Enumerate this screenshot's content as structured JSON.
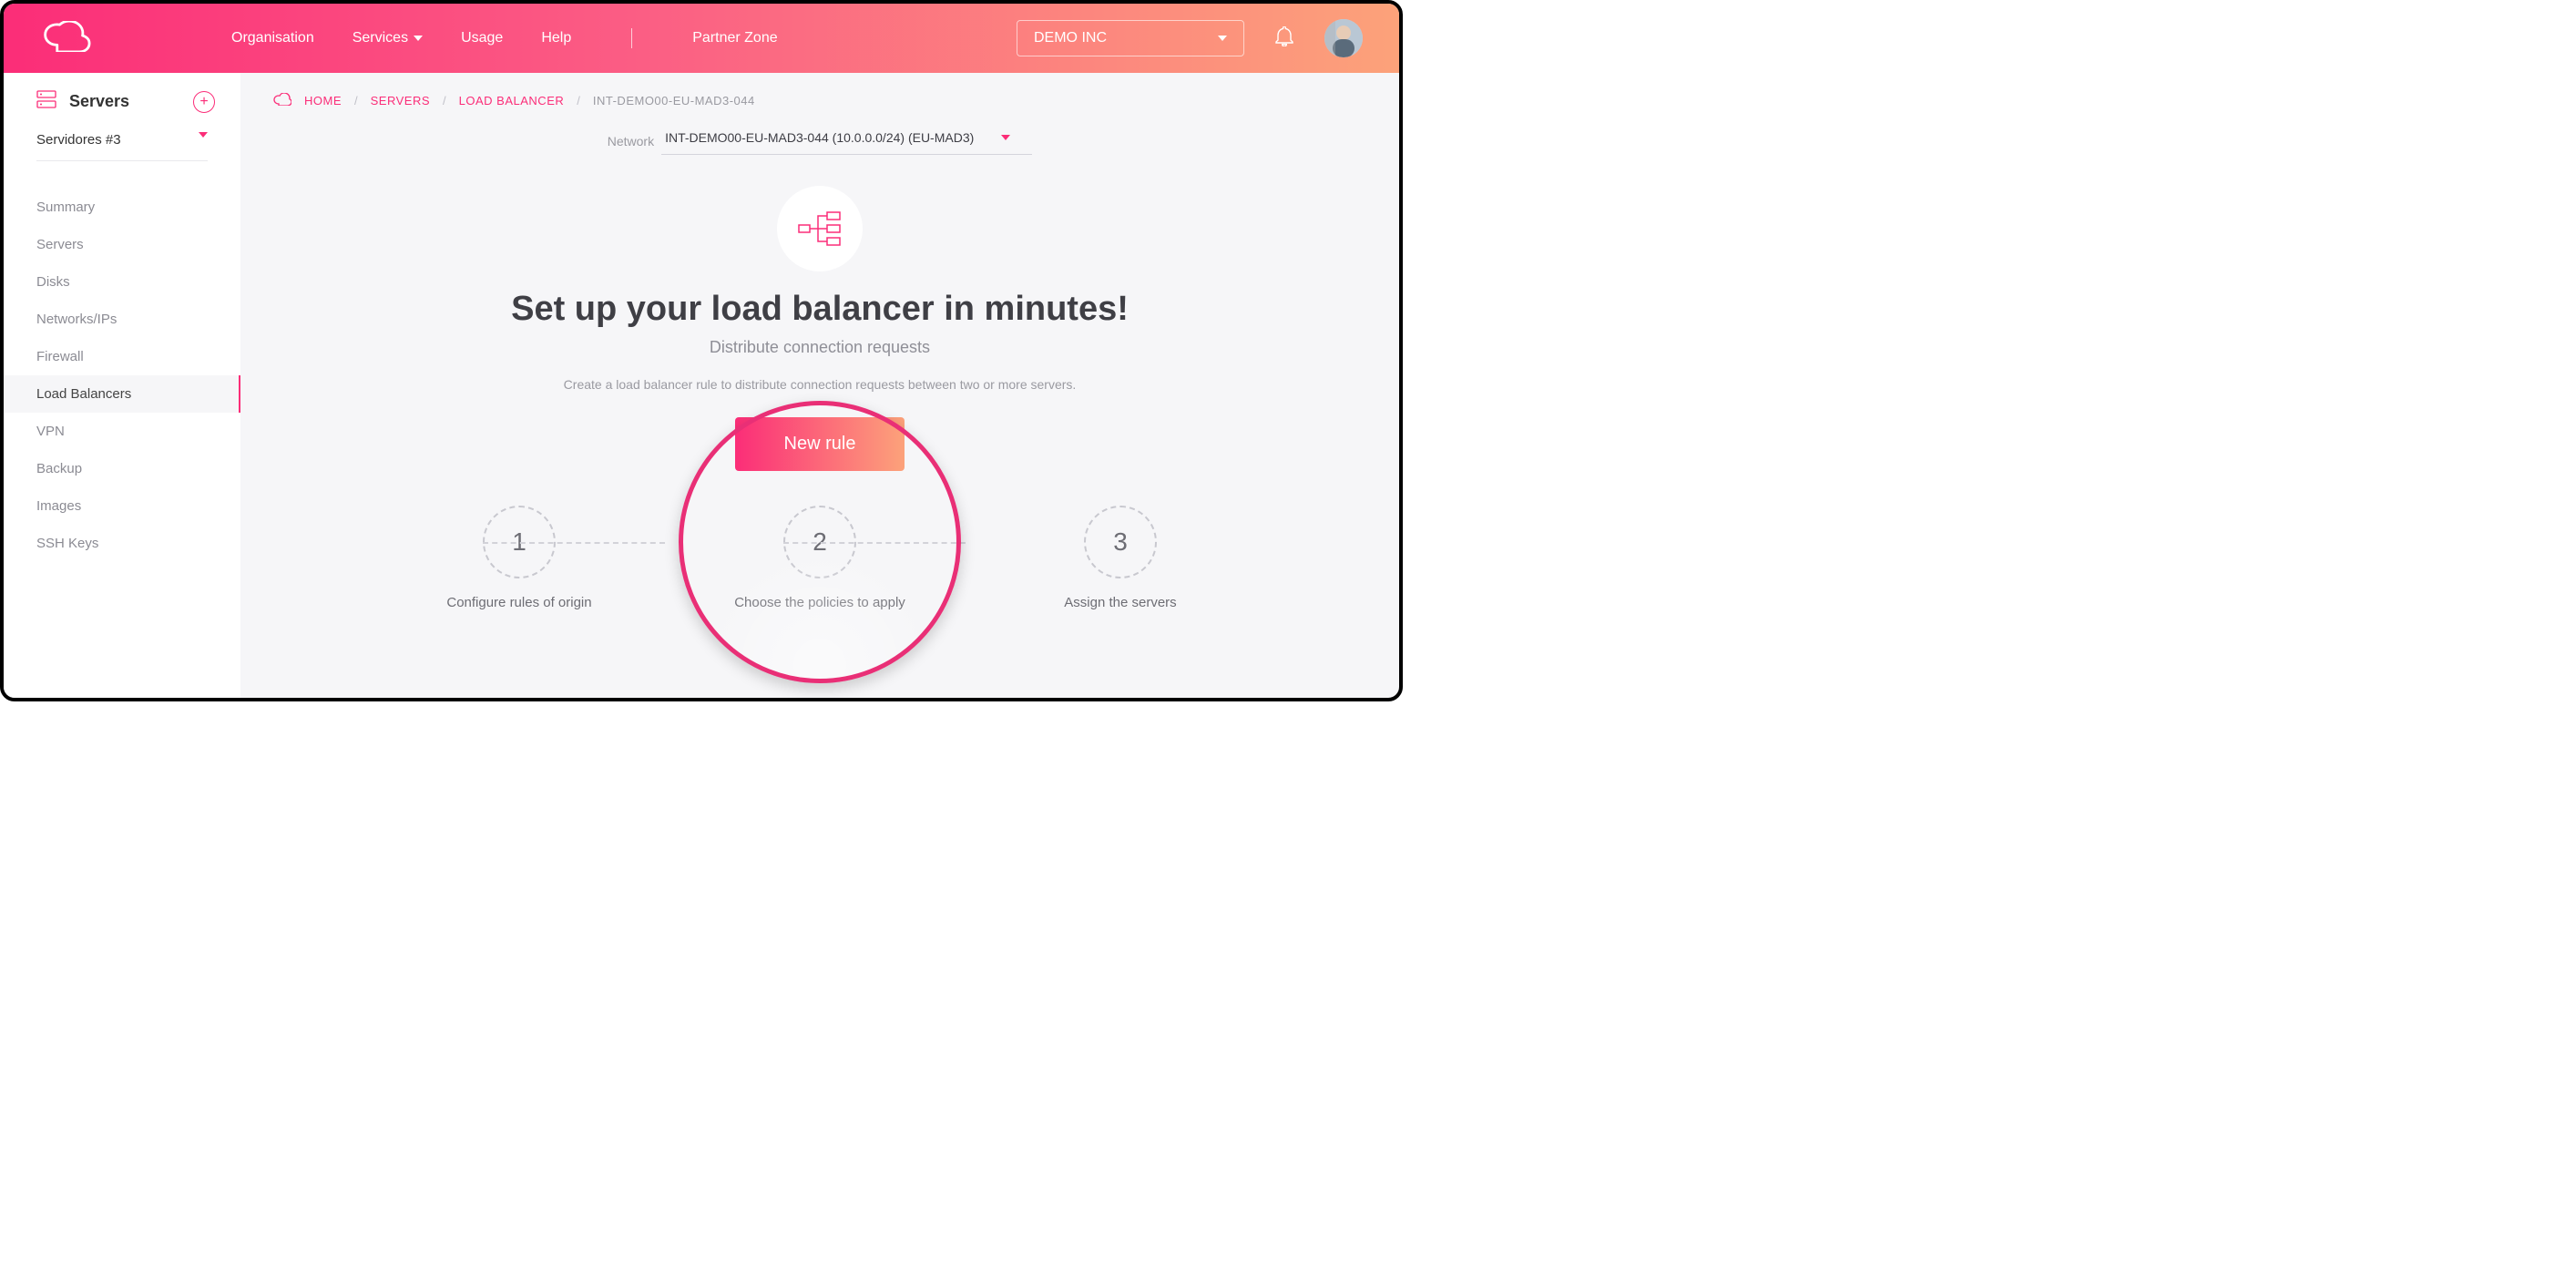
{
  "nav": {
    "items": [
      "Organisation",
      "Services",
      "Usage",
      "Help"
    ],
    "partner": "Partner Zone",
    "org": "DEMO INC"
  },
  "sidebar": {
    "title": "Servers",
    "group": "Servidores #3",
    "items": [
      "Summary",
      "Servers",
      "Disks",
      "Networks/IPs",
      "Firewall",
      "Load Balancers",
      "VPN",
      "Backup",
      "Images",
      "SSH Keys"
    ],
    "activeIndex": 5
  },
  "breadcrumb": {
    "home": "HOME",
    "servers": "SERVERS",
    "lb": "LOAD BALANCER",
    "current": "INT-DEMO00-EU-MAD3-044"
  },
  "network": {
    "label": "Network",
    "value": "INT-DEMO00-EU-MAD3-044 (10.0.0.0/24) (EU-MAD3)"
  },
  "hero": {
    "title": "Set up your load balancer in minutes!",
    "sub": "Distribute connection requests",
    "desc": "Create a load balancer rule to distribute connection requests between two or more servers.",
    "cta": "New rule"
  },
  "steps": [
    {
      "n": "1",
      "label": "Configure rules of origin"
    },
    {
      "n": "2",
      "label": "Choose the policies to apply"
    },
    {
      "n": "3",
      "label": "Assign the servers"
    }
  ]
}
